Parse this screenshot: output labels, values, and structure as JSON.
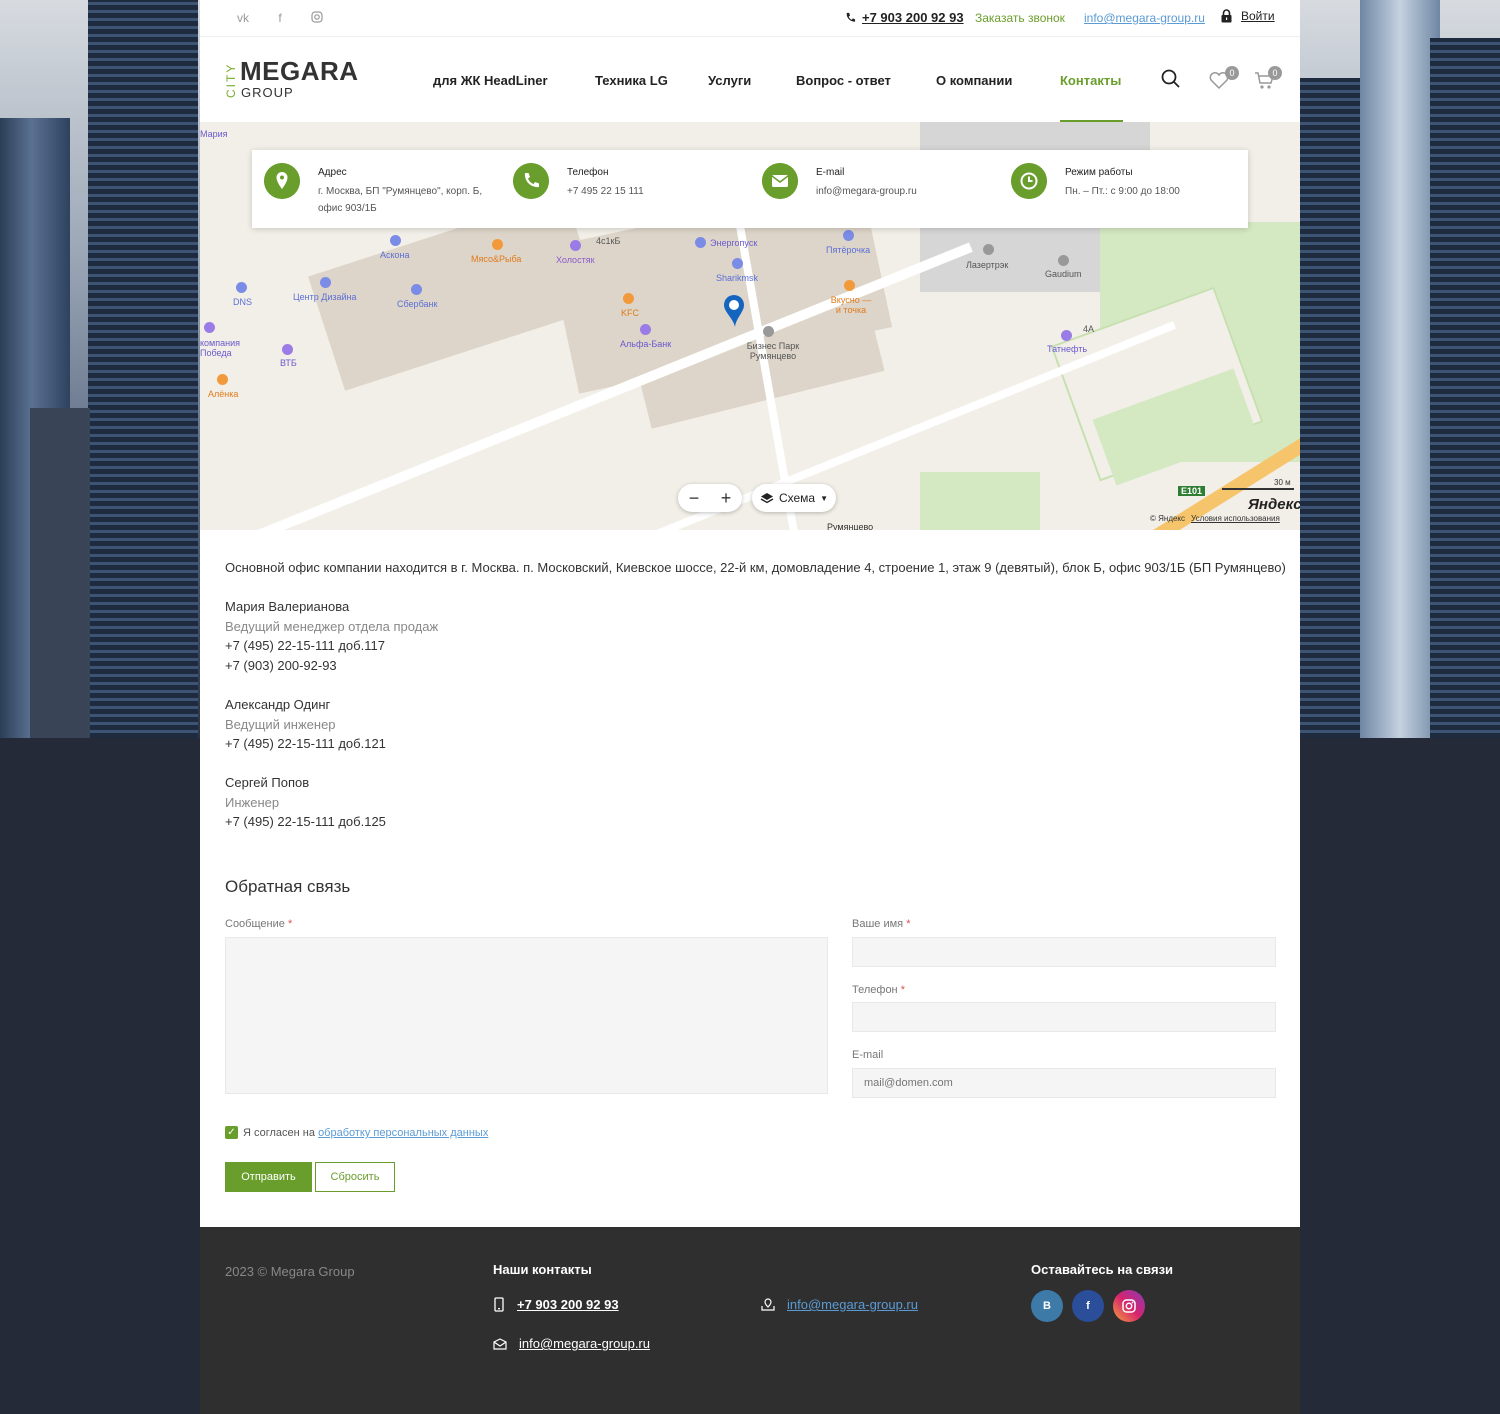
{
  "topbar": {
    "social": [
      "vk-icon",
      "facebook-icon",
      "instagram-icon"
    ],
    "phone": "+7 903 200 92 93",
    "callback": "Заказать звонок",
    "email": "info@megara-group.ru",
    "login": "Войти"
  },
  "logo": {
    "city": "CITY",
    "name": "MEGARA",
    "group": "GROUP"
  },
  "nav": [
    {
      "label": "для ЖК HeadLiner"
    },
    {
      "label": "Техника LG"
    },
    {
      "label": "Услуги"
    },
    {
      "label": "Вопрос - ответ"
    },
    {
      "label": "О компании"
    },
    {
      "label": "Контакты",
      "active": true
    }
  ],
  "header_icons": {
    "favorites_count": "0",
    "cart_count": "0"
  },
  "map": {
    "labels": [
      "Мария",
      "Аскона",
      "Мясо&Рыба",
      "Холостяк",
      "4с1кБ",
      "Энергопуск",
      "Пятёрочка",
      "Лазертрэк",
      "Gaudium",
      "DNS",
      "Центр Дизайна",
      "Сбербанк",
      "KFC",
      "Sharikmsk",
      "Альфа-Банк",
      "Бизнес Парк Румянцево",
      "Вкусно — и точка",
      "4А",
      "Татнефть",
      "компания Победа",
      "ВТБ",
      "Алёнка",
      "E101",
      "Румянцево"
    ],
    "scheme": "Схема",
    "scale": "30 м",
    "brand": "Яндекс",
    "copyright": "© Яндекс",
    "terms": "Условия использования"
  },
  "info": [
    {
      "title": "Адрес",
      "value": "г. Москва, БП \"Румянцево\", корп. Б, офис 903/1Б",
      "icon": "location-icon"
    },
    {
      "title": "Телефон",
      "value": "+7 495 22 15 111",
      "icon": "phone-icon"
    },
    {
      "title": "E-mail",
      "value": "info@megara-group.ru",
      "icon": "mail-icon"
    },
    {
      "title": "Режим работы",
      "value": "Пн. – Пт.: с 9:00 до 18:00",
      "icon": "clock-icon"
    }
  ],
  "office": "Основной офис компании находится в г. Москва. п. Московский, Киевское шоссе, 22-й км, домовладение 4, строение 1, этаж 9 (девятый), блок Б, офис 903/1Б (БП Румянцево)",
  "contacts": [
    {
      "name": "Мария Валерианова",
      "role": "Ведущий менеджер отдела продаж",
      "phones": [
        "+7 (495) 22-15-111 доб.117",
        "+7 (903) 200-92-93"
      ]
    },
    {
      "name": "Александр Одинг",
      "role": "Ведущий инженер",
      "phones": [
        "+7 (495) 22-15-111 доб.121"
      ]
    },
    {
      "name": "Сергей Попов",
      "role": "Инженер",
      "phones": [
        "+7 (495) 22-15-111 доб.125"
      ]
    }
  ],
  "form": {
    "title": "Обратная связь",
    "message_label": "Сообщение",
    "name_label": "Ваше имя",
    "phone_label": "Телефон",
    "email_label": "E-mail",
    "required_mark": "*",
    "email_placeholder": "mail@domen.com",
    "agree_text": "Я согласен на",
    "agree_link": "обработку персональных данных",
    "agree_checked": true,
    "submit": "Отправить",
    "reset": "Сбросить"
  },
  "footer": {
    "copyright": "2023 © Megara Group",
    "contacts_title": "Наши контакты",
    "phone": "+7 903 200 92 93",
    "email1": "info@megara-group.ru",
    "email2": "info@megara-group.ru",
    "social_title": "Оставайтесь на связи",
    "social": [
      {
        "label": "В",
        "icon": "vk-icon",
        "color": "#3d7aa8"
      },
      {
        "label": "f",
        "icon": "facebook-icon",
        "color": "#2b4e9a"
      },
      {
        "label": "",
        "icon": "instagram-icon",
        "color": "#d6246e"
      }
    ]
  },
  "colors": {
    "accent": "#6a9e2c",
    "link": "#5b9bd5",
    "footer_bg": "#2f2f2f"
  }
}
